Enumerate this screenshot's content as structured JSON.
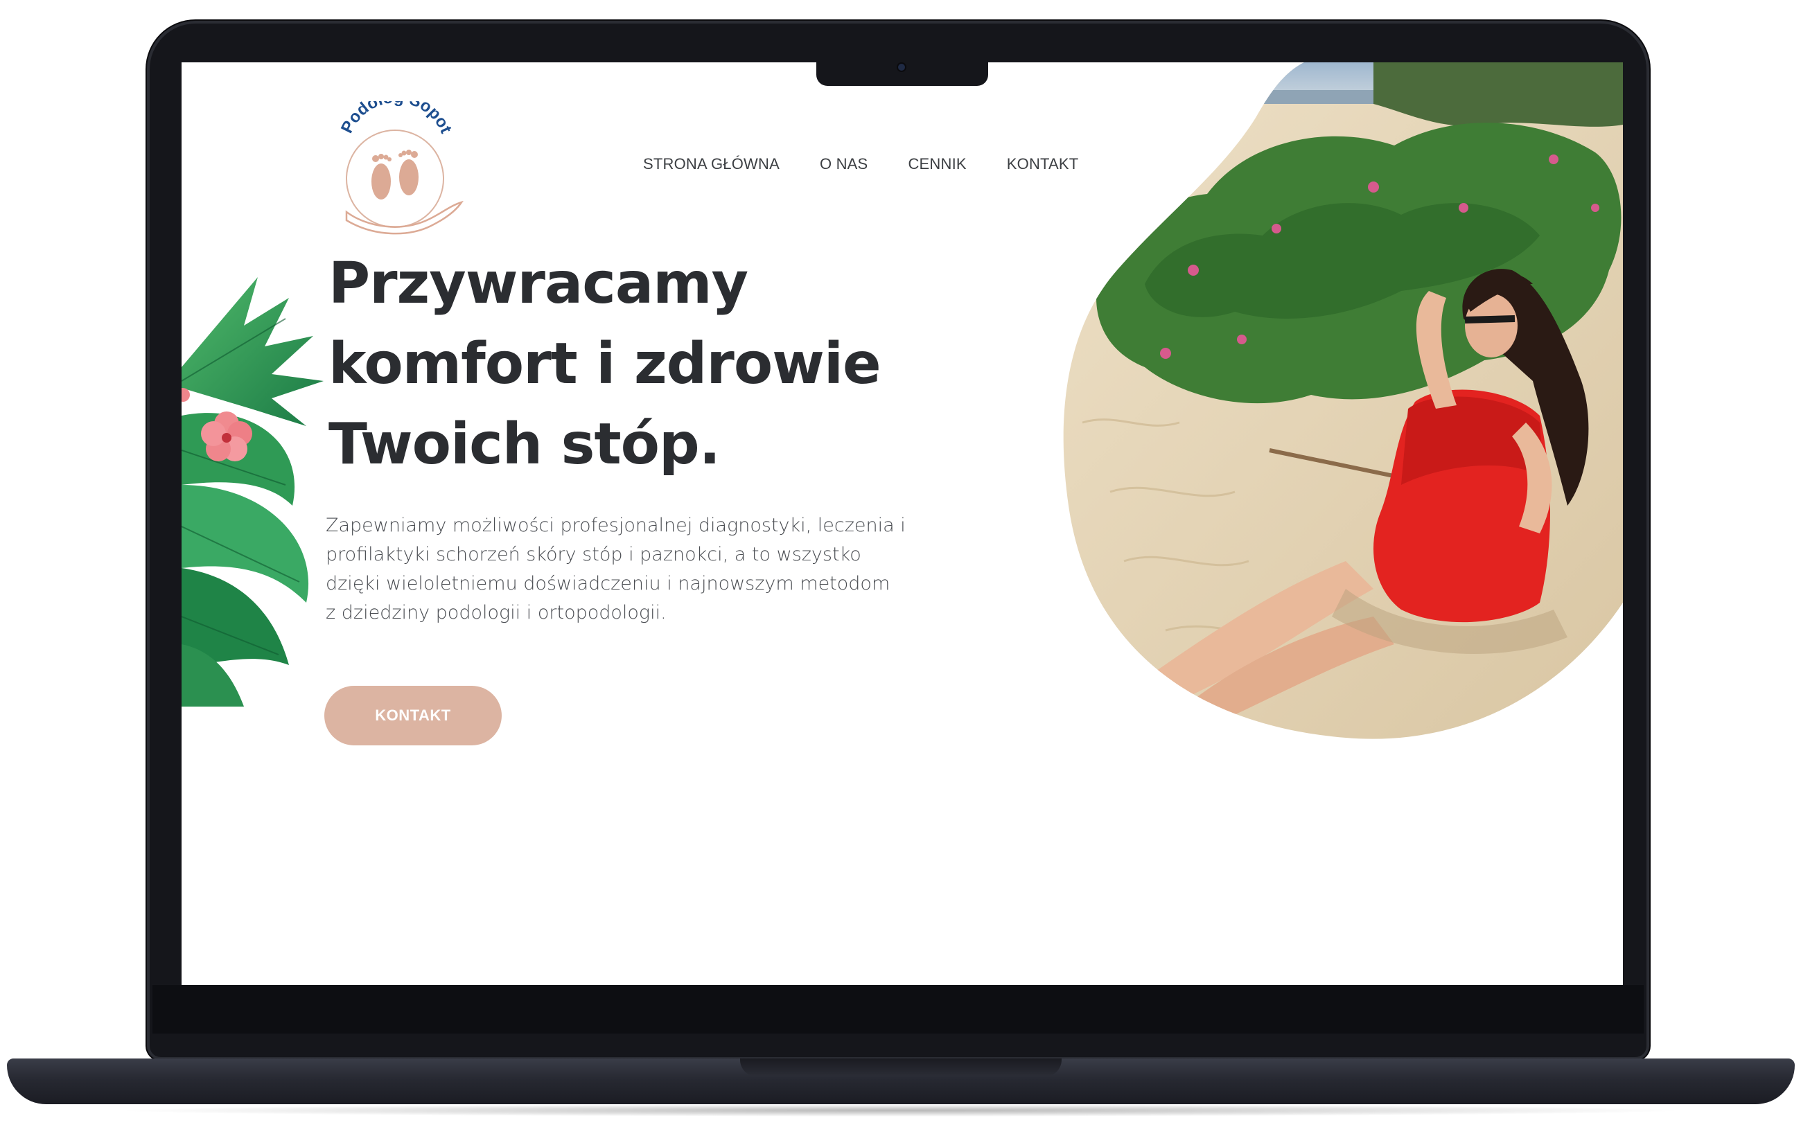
{
  "brand": {
    "logo_text": "Podolog Sopot",
    "colors": {
      "accent": "#dcb4a2",
      "logo_blue": "#1d4e8f",
      "text_dark": "#2b2d31"
    }
  },
  "nav": {
    "items": [
      {
        "label": "STRONA GŁÓWNA"
      },
      {
        "label": "O NAS"
      },
      {
        "label": "CENNIK"
      },
      {
        "label": "KONTAKT"
      }
    ]
  },
  "hero": {
    "title_lines": [
      "Przywracamy",
      "komfort i zdrowie",
      "Twoich stóp."
    ],
    "text_lines": [
      "Zapewniamy możliwości profesjonalnej diagnostyki, leczenia i",
      "profilaktyki schorzeń skóry stóp i paznokci, a to wszystko",
      "dzięki wieloletniemu doświadczeniu i najnowszym metodom",
      "z dziedziny podologii i ortopodologii."
    ],
    "cta_label": "KONTAKT"
  },
  "icons": [
    "feet-logo-icon",
    "hand-logo-icon",
    "camera-icon",
    "palm-leaves-decoration"
  ]
}
